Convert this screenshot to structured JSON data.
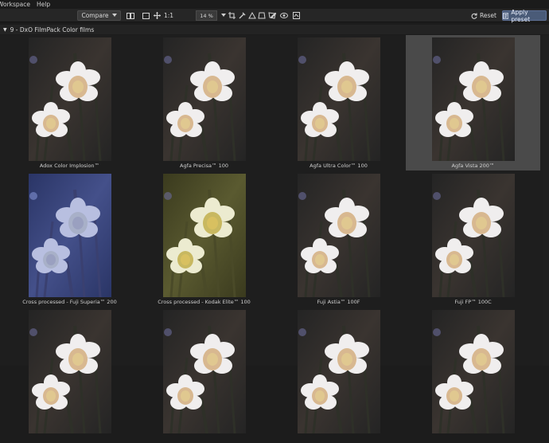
{
  "menu": {
    "items": [
      "Workspace",
      "Help"
    ]
  },
  "toolbar": {
    "compare_label": "Compare",
    "ratio_label": "1:1",
    "zoom_value": "14 %",
    "reset_label": "Reset",
    "apply_label": "Apply preset"
  },
  "section": {
    "title": "9 - DxO FilmPack Color films"
  },
  "presets": [
    {
      "label": "Adox Color Implosion™",
      "tint": "#9a8a88",
      "tone": "normal",
      "selected": false
    },
    {
      "label": "Agfa Precisa™ 100",
      "tint": "#8c8070",
      "tone": "normal",
      "selected": false
    },
    {
      "label": "Agfa Ultra Color™ 100",
      "tint": "#8e8078",
      "tone": "normal",
      "selected": false
    },
    {
      "label": "Agfa Vista 200™",
      "tint": "#908478",
      "tone": "normal",
      "selected": true
    },
    {
      "label": "Cross processed - Fuji Superia™ 200",
      "tint": "#4f5fa0",
      "tone": "blue",
      "selected": false
    },
    {
      "label": "Cross processed - Kodak Elite™ 100",
      "tint": "#8a8540",
      "tone": "yellow",
      "selected": false
    },
    {
      "label": "Fuji Astia™ 100F",
      "tint": "#8e807a",
      "tone": "normal",
      "selected": false
    },
    {
      "label": "Fuji FP™ 100C",
      "tint": "#8a7e74",
      "tone": "normal",
      "selected": false
    },
    {
      "label": "",
      "tint": "#8a7e74",
      "tone": "normal",
      "selected": false
    },
    {
      "label": "",
      "tint": "#8a7e74",
      "tone": "normal",
      "selected": false
    },
    {
      "label": "",
      "tint": "#8a7e74",
      "tone": "normal",
      "selected": false
    },
    {
      "label": "",
      "tint": "#8a7e74",
      "tone": "normal",
      "selected": false
    }
  ],
  "colors": {
    "accent": "#4a5b78",
    "selection": "#4a4a4a",
    "background": "#1e1e1e"
  }
}
